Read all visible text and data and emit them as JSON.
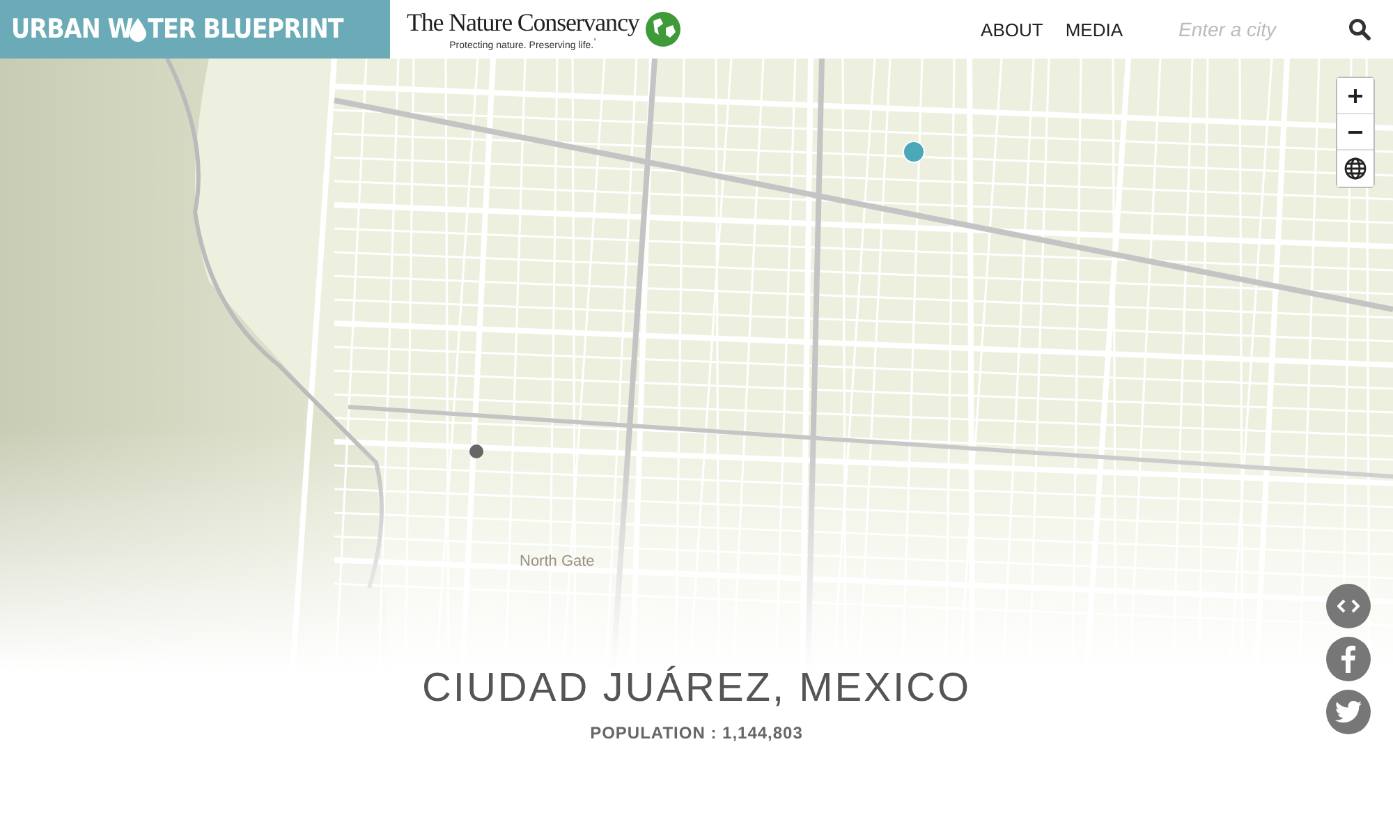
{
  "header": {
    "logo_before": "URBAN W",
    "logo_after": "TER BLUEPRINT",
    "partner_name": "The Nature Conservancy",
    "partner_tagline": "Protecting nature. Preserving life.",
    "partner_mark": "°",
    "nav": [
      "ABOUT",
      "MEDIA"
    ],
    "search": {
      "placeholder": "Enter a city"
    }
  },
  "map": {
    "place_label": "North Gate",
    "markers": [
      {
        "color": "#4aa8b8"
      },
      {
        "color": "#666666"
      }
    ],
    "controls": [
      {
        "kind": "zoom-in"
      },
      {
        "kind": "zoom-out"
      },
      {
        "kind": "layers"
      }
    ]
  },
  "city": {
    "title": "CIUDAD JUÁREZ, MEXICO",
    "population": "POPULATION : 1,144,803"
  },
  "share": [
    {
      "kind": "embed"
    },
    {
      "kind": "facebook"
    },
    {
      "kind": "twitter"
    }
  ]
}
